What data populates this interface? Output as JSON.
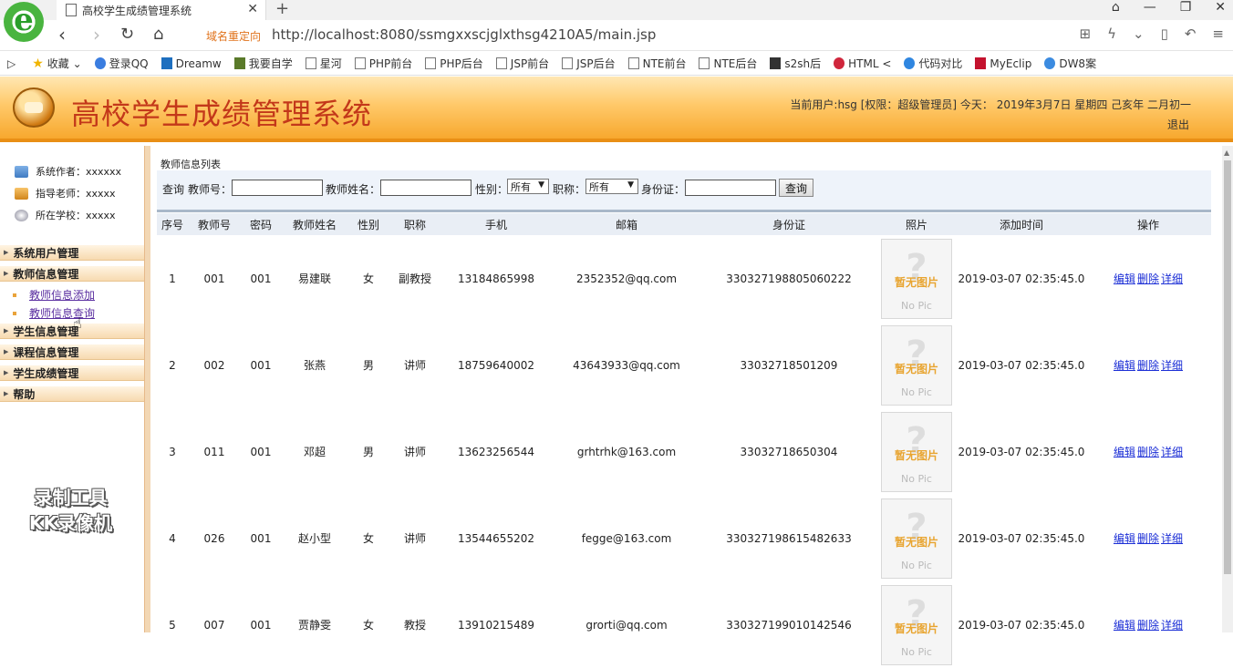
{
  "browser": {
    "tab_title": "高校学生成绩管理系统",
    "redirect_label": "域名重定向",
    "url": "http://localhost:8080/ssmgxxscjglxthsg4210A5/main.jsp",
    "bookmarks": [
      "收藏",
      "登录QQ",
      "Dreamw",
      "我要自学",
      "星河",
      "PHP前台",
      "PHP后台",
      "JSP前台",
      "JSP后台",
      "NTE前台",
      "NTE后台",
      "s2sh后",
      "HTML <",
      "代码对比",
      "MyEclip",
      "DW8案"
    ]
  },
  "header": {
    "title": "高校学生成绩管理系统",
    "user_info": "当前用户:hsg [权限：超级管理员] 今天： 2019年3月7日 星期四 己亥年 二月初一",
    "logout": "退出"
  },
  "sidebar": {
    "info": [
      {
        "label": "系统作者：xxxxxx"
      },
      {
        "label": "指导老师：xxxxx"
      },
      {
        "label": "所在学校：xxxxx"
      }
    ],
    "menus": [
      {
        "label": "系统用户管理"
      },
      {
        "label": "教师信息管理"
      },
      {
        "label": "学生信息管理"
      },
      {
        "label": "课程信息管理"
      },
      {
        "label": "学生成绩管理"
      },
      {
        "label": "帮助"
      }
    ],
    "submenus": [
      {
        "label": "教师信息添加"
      },
      {
        "label": "教师信息查询"
      }
    ]
  },
  "main": {
    "section_title": "教师信息列表",
    "search": {
      "query_label": "查询",
      "teacher_no_label": "教师号：",
      "teacher_name_label": "教师姓名：",
      "gender_label": "性别：",
      "gender_value": "所有",
      "title_label": "职称：",
      "title_value": "所有",
      "id_label": "身份证：",
      "button": "查询"
    },
    "columns": [
      "序号",
      "教师号",
      "密码",
      "教师姓名",
      "性别",
      "职称",
      "手机",
      "邮箱",
      "身份证",
      "照片",
      "添加时间",
      "操作"
    ],
    "photo": {
      "label": "暂无图片",
      "sub": "No Pic"
    },
    "actions": {
      "edit": "编辑",
      "delete": "删除",
      "detail": "详细"
    },
    "rows": [
      {
        "no": "1",
        "tno": "001",
        "pwd": "001",
        "name": "易建联",
        "gender": "女",
        "title": "副教授",
        "phone": "13184865998",
        "email": "2352352@qq.com",
        "idcard": "330327198805060222",
        "time": "2019-03-07 02:35:45.0"
      },
      {
        "no": "2",
        "tno": "002",
        "pwd": "001",
        "name": "张燕",
        "gender": "男",
        "title": "讲师",
        "phone": "18759640002",
        "email": "43643933@qq.com",
        "idcard": "33032718501209",
        "time": "2019-03-07 02:35:45.0"
      },
      {
        "no": "3",
        "tno": "011",
        "pwd": "001",
        "name": "邓超",
        "gender": "男",
        "title": "讲师",
        "phone": "13623256544",
        "email": "grhtrhk@163.com",
        "idcard": "33032718650304",
        "time": "2019-03-07 02:35:45.0"
      },
      {
        "no": "4",
        "tno": "026",
        "pwd": "001",
        "name": "赵小型",
        "gender": "女",
        "title": "讲师",
        "phone": "13544655202",
        "email": "fegge@163.com",
        "idcard": "330327198615482633",
        "time": "2019-03-07 02:35:45.0"
      },
      {
        "no": "5",
        "tno": "007",
        "pwd": "001",
        "name": "贾静雯",
        "gender": "女",
        "title": "教授",
        "phone": "13910215489",
        "email": "grorti@qq.com",
        "idcard": "330327199010142546",
        "time": "2019-03-07 02:35:45.0"
      }
    ]
  },
  "watermark": [
    "录制工具",
    "KK录像机"
  ]
}
